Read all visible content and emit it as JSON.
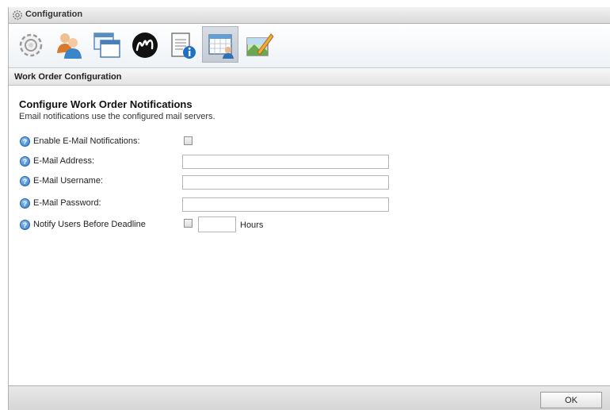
{
  "window": {
    "title": "Configuration",
    "help_glyph": "?"
  },
  "toolbar": {
    "items": [
      {
        "icon": "gear-icon"
      },
      {
        "icon": "users-icon"
      },
      {
        "icon": "windows-icon"
      },
      {
        "icon": "m-logo-icon"
      },
      {
        "icon": "notepad-info-icon"
      },
      {
        "icon": "calendar-user-icon",
        "active": true
      },
      {
        "icon": "picture-edit-icon"
      }
    ]
  },
  "section": {
    "title": "Work Order Configuration"
  },
  "main": {
    "heading": "Configure Work Order Notifications",
    "subtext": "Email notifications use the configured mail servers.",
    "fields": {
      "enable_notifications": {
        "label": "Enable E-Mail Notifications:",
        "checked": false
      },
      "email_address": {
        "label": "E-Mail Address:",
        "value": ""
      },
      "email_username": {
        "label": "E-Mail Username:",
        "value": ""
      },
      "email_password": {
        "label": "E-Mail Password:",
        "value": ""
      },
      "notify_before_deadline": {
        "label": "Notify Users Before Deadline",
        "checked": false,
        "hours_value": "",
        "hours_label": "Hours"
      }
    },
    "help_glyph": "?"
  },
  "footer": {
    "ok_label": "OK"
  }
}
